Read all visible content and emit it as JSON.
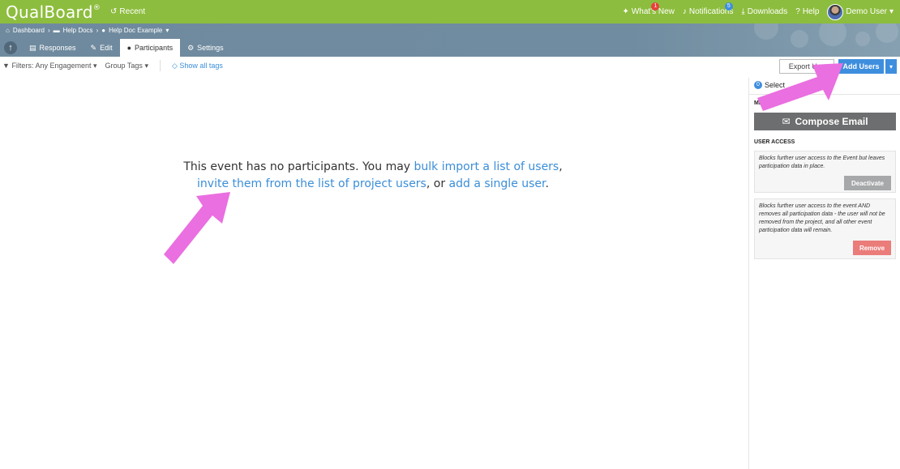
{
  "topbar": {
    "logo": "QualBoard",
    "logo_mark": "®",
    "recent": "Recent",
    "whats_new": "What's New",
    "whats_new_badge": "1",
    "notifications": "Notifications",
    "notifications_badge": "5",
    "downloads": "Downloads",
    "help": "Help",
    "user": "Demo User"
  },
  "breadcrumb": [
    "Dashboard",
    "Help Docs",
    "Help Doc Example"
  ],
  "tabs": [
    "Responses",
    "Edit",
    "Participants",
    "Settings"
  ],
  "filters": {
    "label": "Filters: Any Engagement",
    "group_tags": "Group Tags",
    "show_all": "Show all tags"
  },
  "buttons": {
    "export": "Export Use",
    "add_users": "Add Users"
  },
  "panel": {
    "select_badge": "0",
    "select_label": "Select",
    "messaging": "ME     SERS",
    "compose": "Compose Email",
    "user_access": "USER ACCESS",
    "deactivate_text": "Blocks further user access to the Event but leaves participation data in place.",
    "deactivate": "Deactivate",
    "remove_text": "Blocks further user access to the event AND removes all participation data - the user will not be removed from the project, and all other event participation data will remain.",
    "remove": "Remove"
  },
  "message": {
    "part1": "This event has no participants. You may ",
    "link1": "bulk import a list of users",
    "part2": ",",
    "link2": "invite them from the list of project users",
    "part3": ", or ",
    "link3": "add a single user",
    "part4": "."
  },
  "colors": {
    "topbar": "#8dbd3e",
    "header": "#708ca0",
    "accent": "#3e8ede",
    "arrow": "#ea6fe0",
    "remove": "#ea7c7a"
  }
}
